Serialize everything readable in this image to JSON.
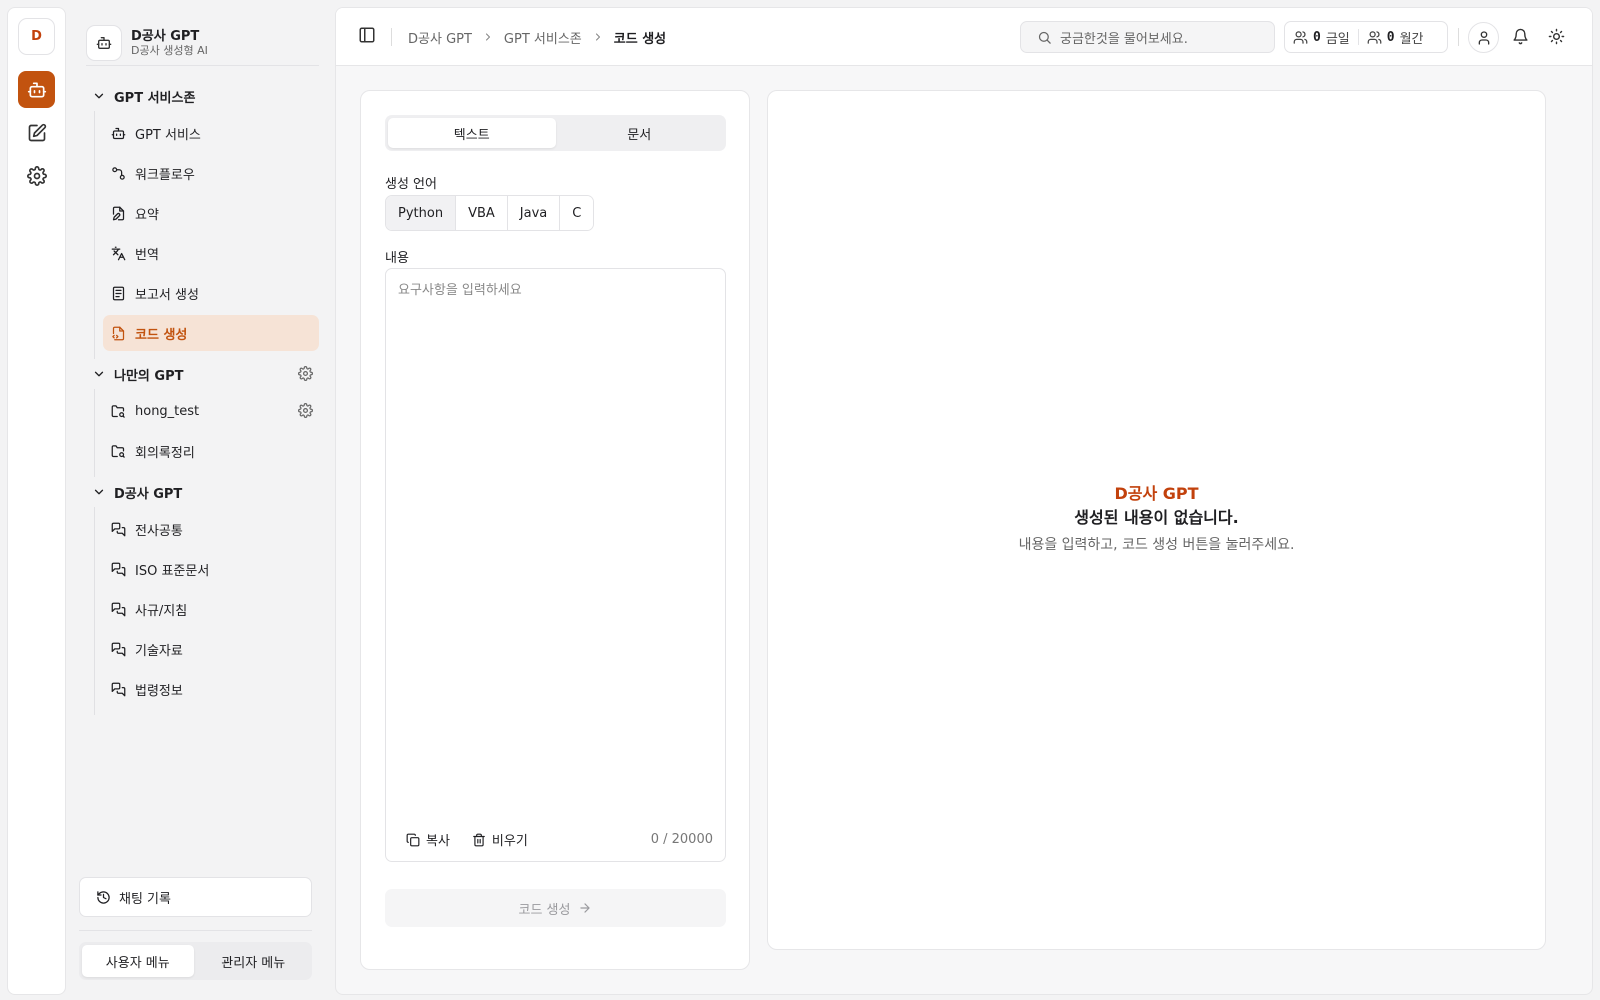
{
  "rail": {
    "avatar_letter": "D",
    "icons": [
      "bot-icon",
      "edit-icon",
      "gear-icon"
    ],
    "accent": "#c2530f"
  },
  "brand": {
    "title": "D공사 GPT",
    "subtitle": "D공사 생성형 AI"
  },
  "nav": {
    "groups": [
      {
        "title": "GPT 서비스존",
        "items": [
          {
            "label": "GPT 서비스",
            "icon": "bot-icon"
          },
          {
            "label": "워크플로우",
            "icon": "workflow-icon"
          },
          {
            "label": "요약",
            "icon": "file-edit-icon"
          },
          {
            "label": "번역",
            "icon": "translate-icon"
          },
          {
            "label": "보고서 생성",
            "icon": "report-icon"
          },
          {
            "label": "코드 생성",
            "icon": "code-file-icon",
            "active": true
          }
        ]
      },
      {
        "title": "나만의 GPT",
        "items": [
          {
            "label": "hong_test",
            "icon": "folder-search-icon"
          },
          {
            "label": "회의록정리",
            "icon": "folder-search-icon"
          }
        ]
      },
      {
        "title": "D공사 GPT",
        "items": [
          {
            "label": "전사공통",
            "icon": "chat-icon"
          },
          {
            "label": "ISO 표준문서",
            "icon": "chat-icon"
          },
          {
            "label": "사규/지침",
            "icon": "chat-icon"
          },
          {
            "label": "기술자료",
            "icon": "chat-icon"
          },
          {
            "label": "법령정보",
            "icon": "chat-icon"
          }
        ]
      }
    ]
  },
  "sidebar_bottom": {
    "history_label": "채팅 기록",
    "user_menu": "사용자 메뉴",
    "admin_menu": "관리자 메뉴"
  },
  "header": {
    "breadcrumbs": [
      "D공사 GPT",
      "GPT 서비스존",
      "코드 생성"
    ],
    "search_placeholder": "궁금한것을 물어보세요.",
    "daily_count": "0",
    "daily_label": "금일",
    "monthly_count": "0",
    "monthly_label": "월간"
  },
  "form": {
    "tabs": [
      "텍스트",
      "문서"
    ],
    "language_label": "생성 언어",
    "languages": [
      "Python",
      "VBA",
      "Java",
      "C"
    ],
    "selected_language": "Python",
    "content_label": "내용",
    "content_placeholder": "요구사항을 입력하세요",
    "content_value": "",
    "copy_label": "복사",
    "clear_label": "비우기",
    "char_count": "0 / 20000",
    "submit_label": "코드 생성"
  },
  "result": {
    "brand": "D공사 GPT",
    "title": "생성된 내용이 없습니다.",
    "description": "내용을 입력하고, 코드 생성 버튼을 눌러주세요."
  }
}
